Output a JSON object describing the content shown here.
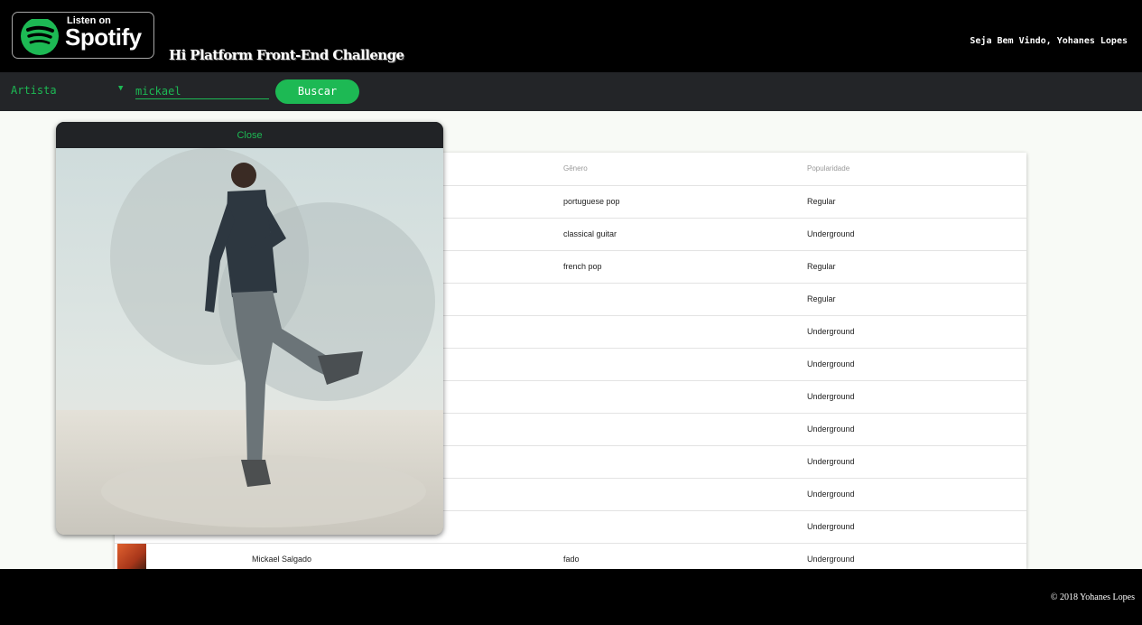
{
  "header": {
    "badge_small": "Listen on",
    "badge_big": "Spotify",
    "challenge_title": "Hi Platform Front-End Challenge",
    "welcome": "Seja Bem Vindo, Yohanes Lopes"
  },
  "search": {
    "type_selected": "Artista",
    "query": "mickael",
    "button_label": "Buscar"
  },
  "table": {
    "headers": [
      "Gênero",
      "Popularidade"
    ],
    "rows": [
      {
        "name": "",
        "genre": "portuguese pop",
        "popularity": "Regular"
      },
      {
        "name": "",
        "genre": "classical guitar",
        "popularity": "Underground"
      },
      {
        "name": "",
        "genre": "french pop",
        "popularity": "Regular"
      },
      {
        "name": "",
        "genre": "",
        "popularity": "Regular"
      },
      {
        "name": "",
        "genre": "",
        "popularity": "Underground"
      },
      {
        "name": "",
        "genre": "",
        "popularity": "Underground"
      },
      {
        "name": "",
        "genre": "",
        "popularity": "Underground"
      },
      {
        "name": "",
        "genre": "",
        "popularity": "Underground"
      },
      {
        "name": "",
        "genre": "",
        "popularity": "Underground"
      },
      {
        "name": "",
        "genre": "",
        "popularity": "Underground"
      },
      {
        "name": "",
        "genre": "",
        "popularity": "Underground"
      },
      {
        "name": "Mickael Salgado",
        "genre": "fado",
        "popularity": "Underground"
      }
    ]
  },
  "modal": {
    "close_label": "Close"
  },
  "footer": {
    "copyright": "© 2018 Yohanes Lopes"
  },
  "colors": {
    "accent": "#1db954",
    "header_bg": "#000000",
    "searchbar_bg": "#232528"
  }
}
